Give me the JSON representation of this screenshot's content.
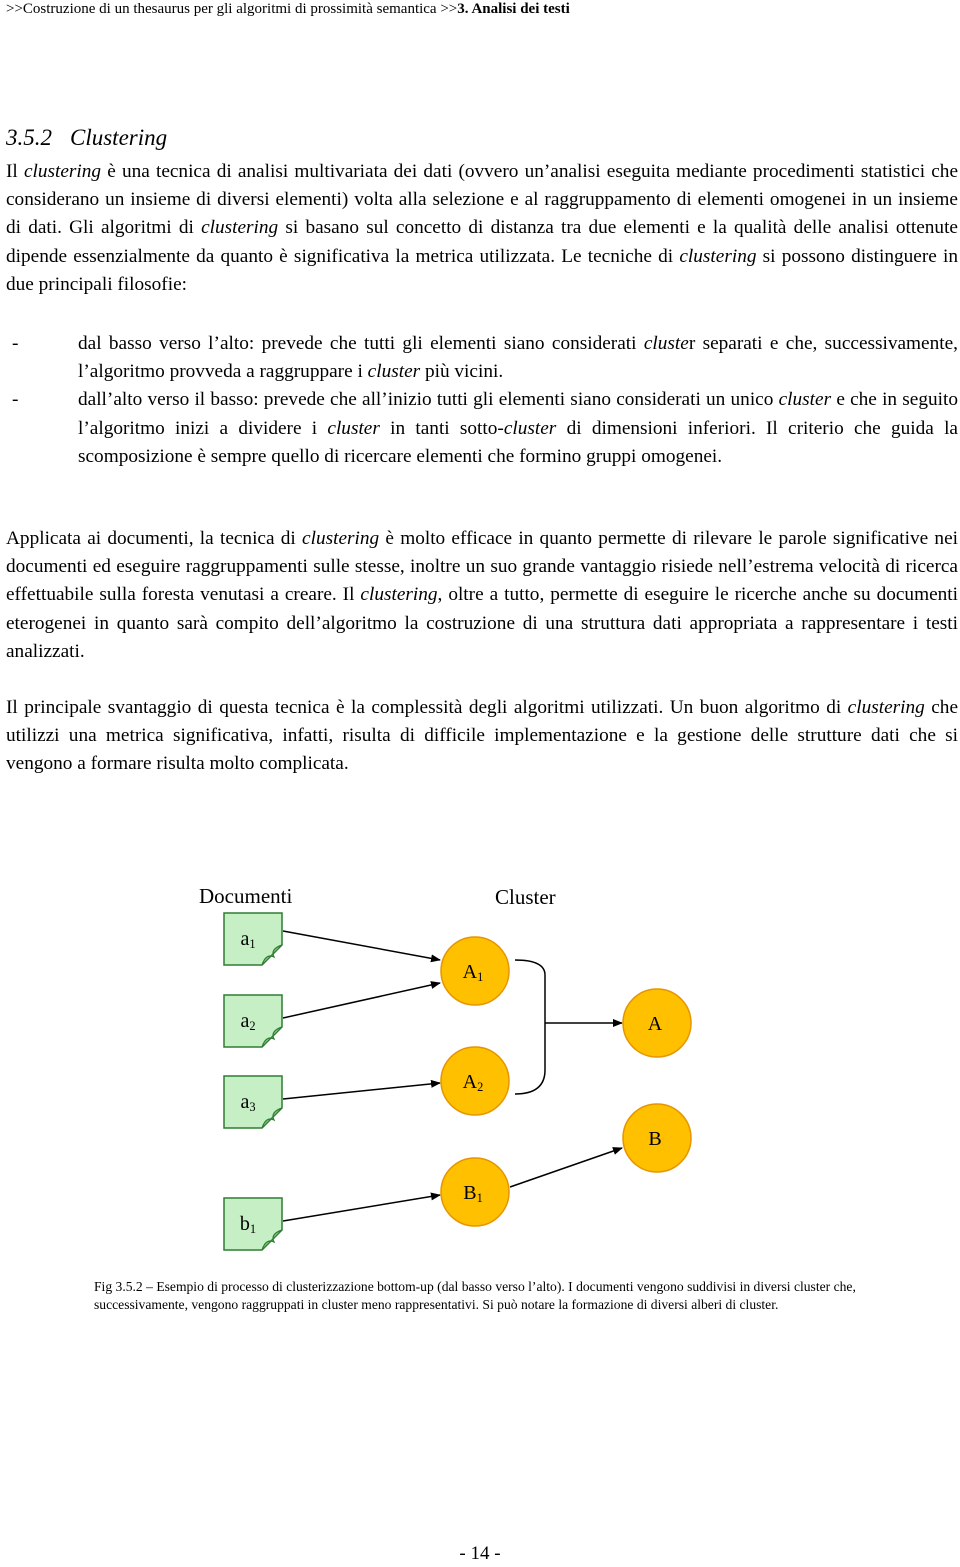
{
  "header": {
    "breadcrumb_prefix": ">>Costruzione di un thesaurus per gli algoritmi di prossimità semantica  >>",
    "breadcrumb_section": "3. Analisi dei testi"
  },
  "section": {
    "number": "3.5.2",
    "title": "Clustering"
  },
  "paragraph1": {
    "p1": "Il ",
    "i1": "clustering",
    "p2": " è una tecnica di analisi multivariata dei dati (ovvero un’analisi eseguita mediante procedimenti statistici che considerano un insieme di diversi elementi) volta alla selezione e al raggruppamento di elementi omogenei in un insieme di dati. Gli algoritmi di ",
    "i2": "clustering",
    "p3": " si basano sul concetto di distanza tra due elementi e la qualità delle analisi ottenute dipende essenzialmente da quanto è significativa la metrica utilizzata. Le tecniche di ",
    "i3": "clustering",
    "p4": " si possono distinguere in due principali filosofie:"
  },
  "bullets": [
    {
      "dash": "-",
      "p1": "dal basso verso l’alto: prevede che tutti gli elementi siano considerati ",
      "i1": "cluste",
      "p2": "r separati e che, successivamente, l’algoritmo provveda a raggruppare i ",
      "i2": "cluster",
      "p3": " più vicini."
    },
    {
      "dash": "-",
      "p1": "dall’alto verso il basso: prevede che all’inizio tutti gli elementi siano considerati un unico ",
      "i1": "cluster",
      "p2": " e che in seguito l’algoritmo inizi a dividere i ",
      "i2": "cluster",
      "p3": " in tanti sotto-",
      "i3": "cluster",
      "p4": " di dimensioni inferiori. Il criterio che guida la scomposizione è sempre quello di ricercare elementi che formino gruppi omogenei."
    }
  ],
  "paragraph2": {
    "p1": "Applicata ai documenti, la tecnica di ",
    "i1": "clustering",
    "p2": " è molto efficace in quanto permette di rilevare le parole significative nei documenti ed eseguire raggruppamenti sulle stesse, inoltre un suo grande vantaggio risiede nell’estrema velocità di ricerca effettuabile sulla foresta venutasi a creare. Il ",
    "i2": "clustering",
    "p3": ", oltre a tutto, permette di eseguire le ricerche anche su documenti eterogenei in quanto sarà compito dell’algoritmo la costruzione di una struttura dati appropriata a rappresentare i testi analizzati."
  },
  "paragraph3": {
    "p1": "Il principale svantaggio di questa tecnica è la complessità degli algoritmi utilizzati. Un buon algoritmo di ",
    "i1": "clustering",
    "p2": " che utilizzi una metrica significativa, infatti, risulta di difficile implementazione e la gestione delle strutture dati che si vengono a formare risulta molto complicata."
  },
  "diagram": {
    "documents_label": "Documenti",
    "clusters_label": "Cluster",
    "documents": [
      {
        "base": "a",
        "sub": "1"
      },
      {
        "base": "a",
        "sub": "2"
      },
      {
        "base": "a",
        "sub": "3"
      },
      {
        "base": "b",
        "sub": "1"
      }
    ],
    "subclusters": [
      {
        "base": "A",
        "sub": "1"
      },
      {
        "base": "A",
        "sub": "2"
      },
      {
        "base": "B",
        "sub": "1"
      }
    ],
    "clusters": [
      {
        "base": "A",
        "sub": ""
      },
      {
        "base": "B",
        "sub": ""
      }
    ],
    "colors": {
      "doc_fill": "#c6efc6",
      "doc_stroke": "#2e7d32",
      "node_fill": "#ffc000",
      "node_stroke": "#e69500",
      "edge": "#000000"
    }
  },
  "caption": "Fig 3.5.2 – Esempio di processo di clusterizzazione bottom-up (dal basso verso l’alto). I documenti vengono suddivisi in diversi cluster che, successivamente, vengono raggruppati in cluster meno rappresentativi. Si può notare la formazione di diversi alberi di cluster.",
  "page_number": "- 14 -"
}
